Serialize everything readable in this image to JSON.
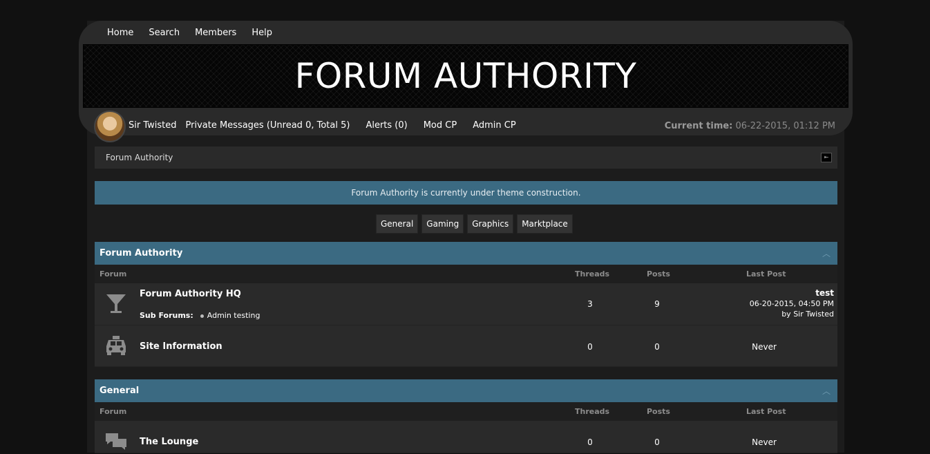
{
  "nav": [
    "Home",
    "Search",
    "Members",
    "Help"
  ],
  "banner_title": "FORUM AUTHORITY",
  "user": {
    "name": "Sir Twisted",
    "private_messages": "Private Messages (Unread 0, Total 5)",
    "alerts": "Alerts (0)",
    "mod_cp": "Mod CP",
    "admin_cp": "Admin CP"
  },
  "current_time": {
    "label": "Current time:",
    "value": "06-22-2015, 01:12 PM"
  },
  "breadcrumb": "Forum Authority",
  "notice": "Forum Authority is currently under theme construction.",
  "tabs": [
    "General",
    "Gaming",
    "Graphics",
    "Marktplace"
  ],
  "columns": {
    "forum": "Forum",
    "threads": "Threads",
    "posts": "Posts",
    "last_post": "Last Post"
  },
  "categories": [
    {
      "title": "Forum Authority",
      "forums": [
        {
          "name": "Forum Authority HQ",
          "icon": "cocktail-glass-icon",
          "threads": "3",
          "posts": "9",
          "sub_forums_label": "Sub Forums:",
          "sub_forum": "Admin testing",
          "last_post": {
            "title": "test",
            "date": "06-20-2015, 04:50 PM",
            "by": "by Sir Twisted"
          }
        },
        {
          "name": "Site Information",
          "icon": "taxi-icon",
          "threads": "0",
          "posts": "0",
          "last_post_text": "Never"
        }
      ]
    },
    {
      "title": "General",
      "forums": [
        {
          "name": "The Lounge",
          "icon": "chat-bubbles-icon",
          "threads": "0",
          "posts": "0",
          "last_post_text": "Never"
        }
      ]
    }
  ],
  "colors": {
    "accent": "#3b6a82",
    "background": "#111111",
    "panel": "#2a2a2a"
  }
}
